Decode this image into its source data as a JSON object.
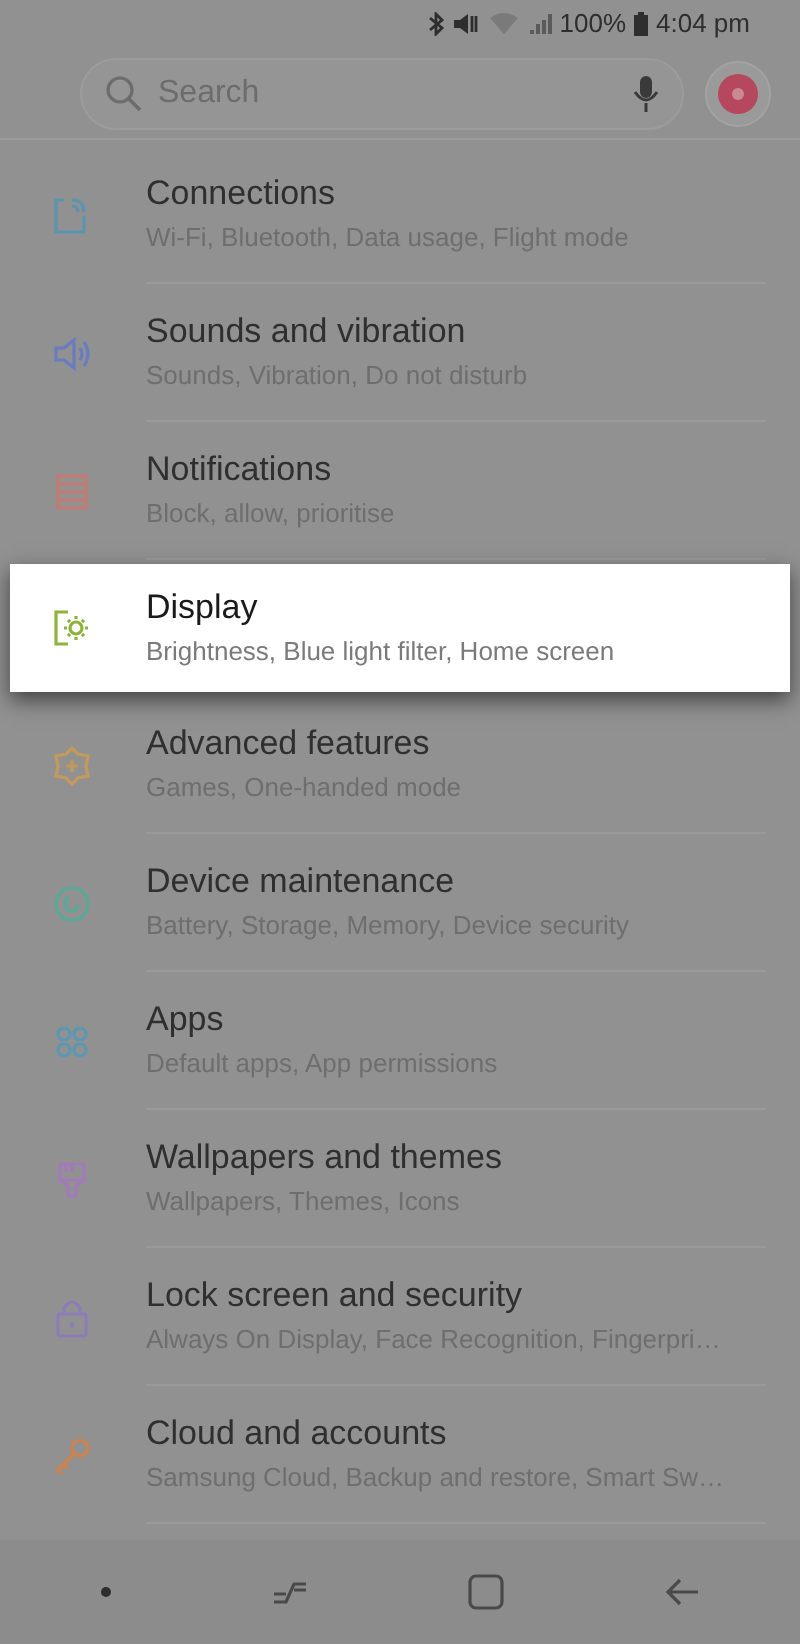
{
  "status_bar": {
    "battery": "100%",
    "time": "4:04 pm"
  },
  "search": {
    "placeholder": "Search"
  },
  "items": [
    {
      "title": "Connections",
      "subtitle": "Wi-Fi, Bluetooth, Data usage, Flight mode",
      "color": "#5c93ad",
      "selected": false
    },
    {
      "title": "Sounds and vibration",
      "subtitle": "Sounds, Vibration, Do not disturb",
      "color": "#6a7cc0",
      "selected": false
    },
    {
      "title": "Notifications",
      "subtitle": "Block, allow, prioritise",
      "color": "#c47a72",
      "selected": false
    },
    {
      "title": "Display",
      "subtitle": "Brightness, Blue light filter, Home screen",
      "color": "#8cb43a",
      "selected": true
    },
    {
      "title": "Advanced features",
      "subtitle": "Games, One-handed mode",
      "color": "#c49a5c",
      "selected": false
    },
    {
      "title": "Device maintenance",
      "subtitle": "Battery, Storage, Memory, Device security",
      "color": "#5aa897",
      "selected": false
    },
    {
      "title": "Apps",
      "subtitle": "Default apps, App permissions",
      "color": "#5b97b0",
      "selected": false
    },
    {
      "title": "Wallpapers and themes",
      "subtitle": "Wallpapers, Themes, Icons",
      "color": "#a27ab9",
      "selected": false
    },
    {
      "title": "Lock screen and security",
      "subtitle": "Always On Display, Face Recognition, Fingerpri…",
      "color": "#8c7cba",
      "selected": false
    },
    {
      "title": "Cloud and accounts",
      "subtitle": "Samsung Cloud, Backup and restore, Smart Sw…",
      "color": "#d0814c",
      "selected": false
    }
  ]
}
